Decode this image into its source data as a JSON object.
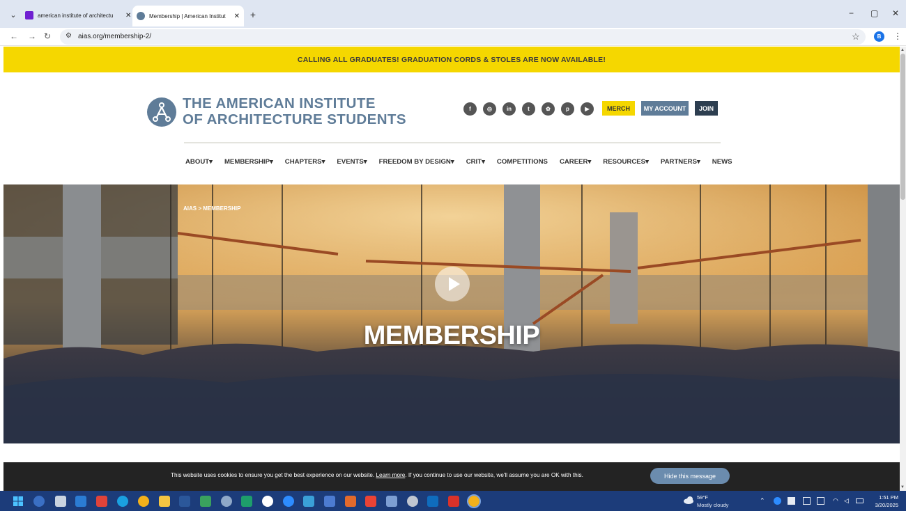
{
  "browser": {
    "tabs": [
      {
        "title": "american institute of architectu",
        "favicon_color": "#6f1fd1"
      },
      {
        "title": "Membership | American Institut",
        "favicon_color": "#5f7c98"
      }
    ],
    "new_tab": "+",
    "url": "aias.org/membership-2/",
    "profile_initial": "B",
    "controls": {
      "minimize": "−",
      "restore": "▢",
      "close": "✕"
    }
  },
  "promo_banner": "CALLING ALL GRADUATES! GRADUATION CORDS & STOLES ARE NOW AVAILABLE!",
  "logo": {
    "line1": "THE AMERICAN INSTITUTE",
    "line2": "OF ARCHITECTURE STUDENTS"
  },
  "social_icons": [
    "facebook-icon",
    "instagram-icon",
    "linkedin-icon",
    "twitter-icon",
    "snapchat-icon",
    "pinterest-icon",
    "youtube-icon"
  ],
  "social_glyphs": [
    "f",
    "◎",
    "in",
    "t",
    "✿",
    "p",
    "▶"
  ],
  "header_buttons": {
    "merch": "MERCH",
    "my_account": "MY ACCOUNT",
    "join": "JOIN"
  },
  "nav": [
    {
      "label": "ABOUT",
      "dropdown": true
    },
    {
      "label": "MEMBERSHIP",
      "dropdown": true
    },
    {
      "label": "CHAPTERS",
      "dropdown": true
    },
    {
      "label": "EVENTS",
      "dropdown": true
    },
    {
      "label": "FREEDOM BY DESIGN",
      "dropdown": true
    },
    {
      "label": "CRIT",
      "dropdown": true
    },
    {
      "label": "COMPETITIONS",
      "dropdown": false
    },
    {
      "label": "CAREER",
      "dropdown": true
    },
    {
      "label": "RESOURCES",
      "dropdown": true
    },
    {
      "label": "PARTNERS",
      "dropdown": true
    },
    {
      "label": "NEWS",
      "dropdown": false
    }
  ],
  "hero": {
    "breadcrumb": "AIAS > MEMBERSHIP",
    "title": "MEMBERSHIP"
  },
  "cookie": {
    "before_link": "This website uses cookies to ensure you get the best experience on our website. ",
    "link": "Learn more",
    "after_link": ". If you continue to use our website, we'll assume you are OK with this.",
    "button": "Hide this message"
  },
  "taskbar": {
    "weather_temp": "59°F",
    "weather_desc": "Mostly cloudy",
    "time": "1:51 PM",
    "date": "3/20/2025"
  },
  "colors": {
    "brand_blue": "#5f7c98",
    "brand_dark": "#2d3e50",
    "promo_yellow": "#f5d700",
    "taskbar": "#1c3c7a"
  }
}
